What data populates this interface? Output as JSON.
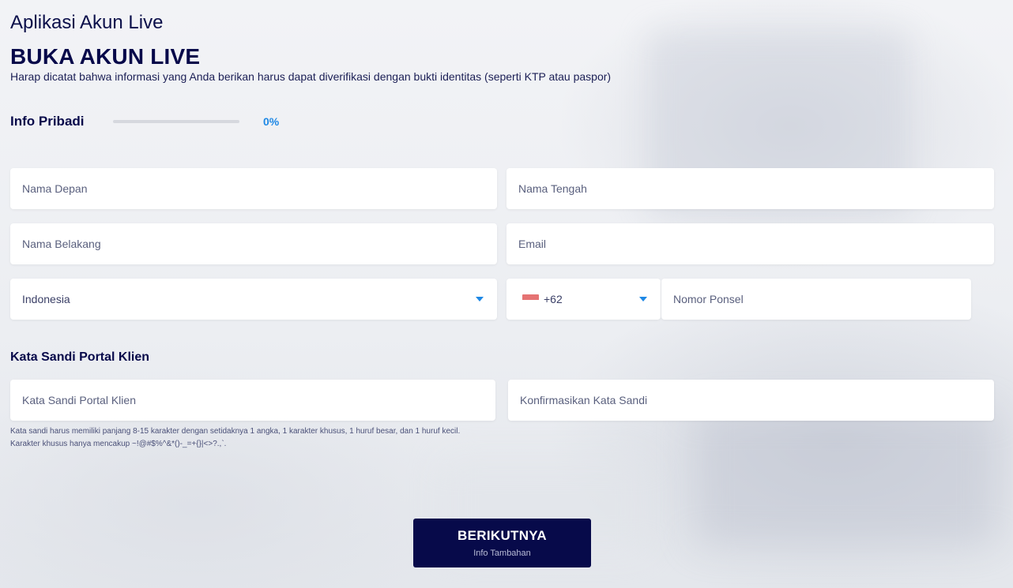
{
  "header": {
    "app_title": "Aplikasi Akun Live",
    "page_title": "BUKA AKUN LIVE",
    "subtitle": "Harap dicatat bahwa informasi yang Anda berikan harus dapat diverifikasi dengan bukti identitas (seperti KTP atau paspor)"
  },
  "section": {
    "title": "Info Pribadi",
    "progress_percent": 0,
    "progress_label": "0%"
  },
  "form": {
    "first_name": {
      "placeholder": "Nama Depan",
      "value": ""
    },
    "middle_name": {
      "placeholder": "Nama Tengah",
      "value": ""
    },
    "last_name": {
      "placeholder": "Nama Belakang",
      "value": ""
    },
    "email": {
      "placeholder": "Email",
      "value": ""
    },
    "country": {
      "selected": "Indonesia"
    },
    "dial_code": {
      "selected": "+62",
      "flag": "indonesia-flag-icon"
    },
    "phone": {
      "placeholder": "Nomor Ponsel",
      "value": ""
    }
  },
  "password": {
    "title": "Kata Sandi Portal Klien",
    "password_field": {
      "placeholder": "Kata Sandi Portal Klien",
      "value": ""
    },
    "confirm_field": {
      "placeholder": "Konfirmasikan Kata Sandi",
      "value": ""
    },
    "hint_line1": "Kata sandi harus memiliki panjang 8-15 karakter dengan setidaknya 1 angka, 1 karakter khusus, 1 huruf besar, dan 1 huruf kecil.",
    "hint_line2": "Karakter khusus hanya mencakup ~!@#$%^&*()-_=+{}|<>?.,`."
  },
  "next_button": {
    "label": "BERIKUTNYA",
    "sublabel": "Info Tambahan"
  },
  "colors": {
    "primary_navy": "#070a4a",
    "accent_blue": "#1e88e5",
    "flag_red": "#e57373"
  }
}
